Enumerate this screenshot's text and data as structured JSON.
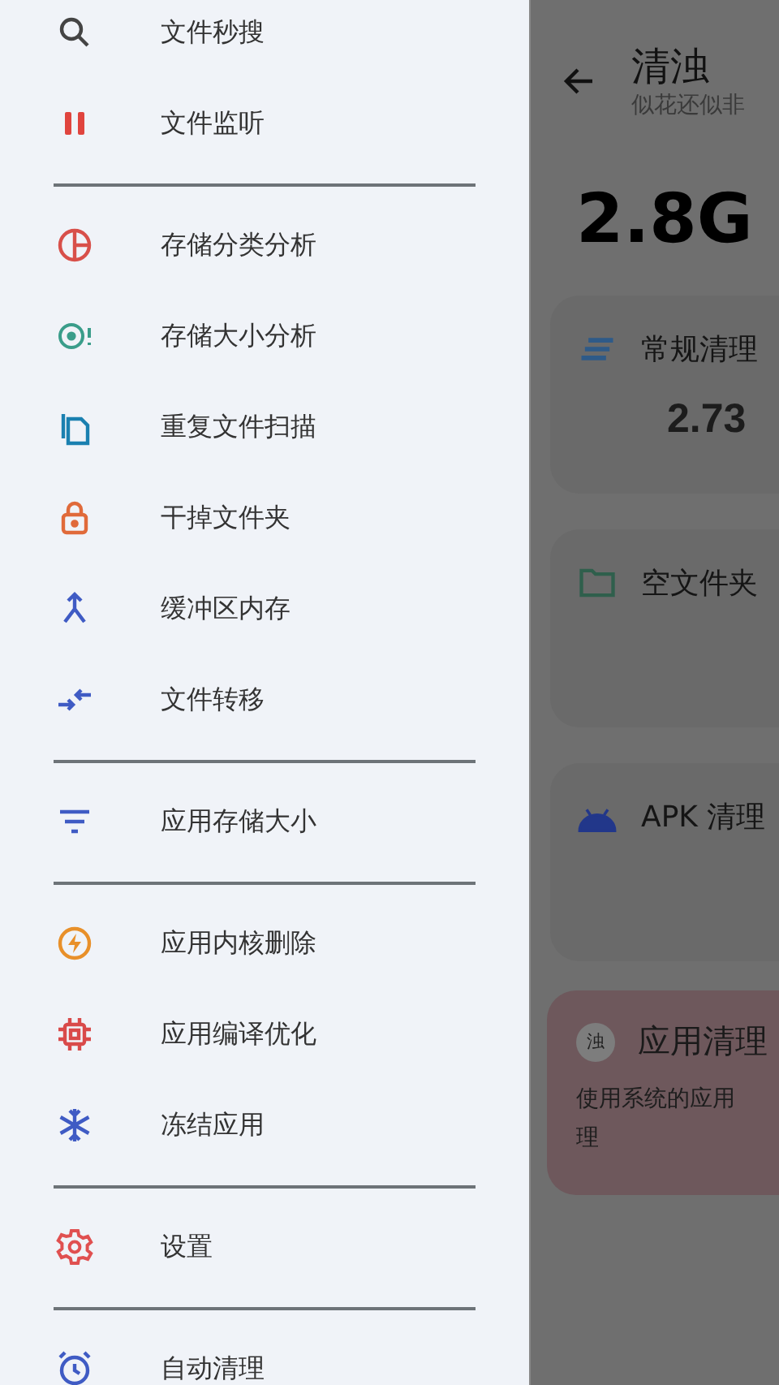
{
  "drawer": {
    "sections": [
      [
        {
          "label": "文件秒搜",
          "kind": "search"
        },
        {
          "label": "文件监听",
          "kind": "pause"
        }
      ],
      [
        {
          "label": "存储分类分析",
          "kind": "pie"
        },
        {
          "label": "存储大小分析",
          "kind": "target"
        },
        {
          "label": "重复文件扫描",
          "kind": "copy"
        },
        {
          "label": "干掉文件夹",
          "kind": "lock"
        },
        {
          "label": "缓冲区内存",
          "kind": "merge"
        },
        {
          "label": "文件转移",
          "kind": "transfer"
        }
      ],
      [
        {
          "label": "应用存储大小",
          "kind": "filter"
        }
      ],
      [
        {
          "label": "应用内核删除",
          "kind": "bolt"
        },
        {
          "label": "应用编译优化",
          "kind": "chip"
        },
        {
          "label": "冻结应用",
          "kind": "snow"
        }
      ],
      [
        {
          "label": "设置",
          "kind": "gear"
        }
      ],
      [
        {
          "label": "自动清理",
          "kind": "alarm"
        }
      ]
    ]
  },
  "page": {
    "title": "清浊",
    "subtitle": "似花还似非",
    "total": "2.8G",
    "cards": [
      {
        "kind": "lines",
        "title": "常规清理",
        "value": "2.73"
      },
      {
        "kind": "folder",
        "title": "空文件夹"
      },
      {
        "kind": "android",
        "title": "APK 清理"
      }
    ],
    "app_card": {
      "avatar": "浊",
      "title": "应用清理",
      "desc_lines": [
        "使用系统的应用",
        "理"
      ]
    }
  }
}
